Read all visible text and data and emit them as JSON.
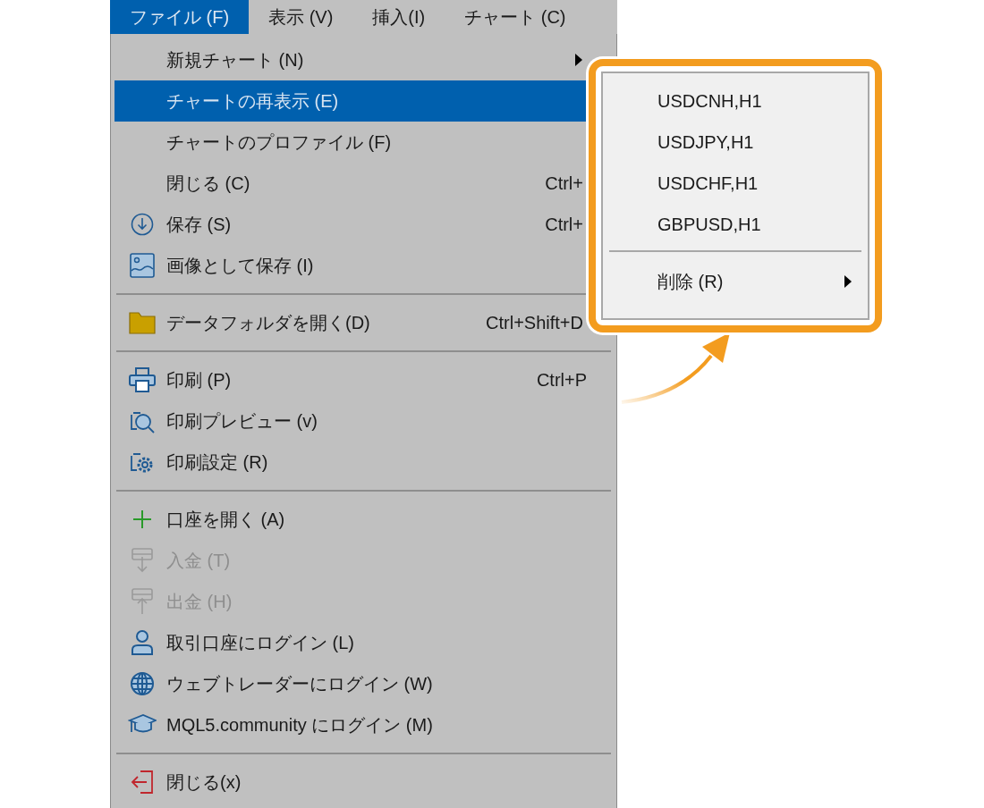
{
  "menubar": [
    {
      "label": "ファイル (F)",
      "selected": true
    },
    {
      "label": "表示 (V)",
      "selected": false
    },
    {
      "label": "挿入(I)",
      "selected": false
    },
    {
      "label": "チャート (C)",
      "selected": false
    }
  ],
  "menu": {
    "items": [
      {
        "kind": "item",
        "label": "新規チャート (N)",
        "submenu": true,
        "selected": false,
        "disabled": false
      },
      {
        "kind": "item",
        "label": "チャートの再表示 (E)",
        "selected": true,
        "disabled": false
      },
      {
        "kind": "item",
        "label": "チャートのプロファイル (F)",
        "selected": false,
        "disabled": false
      },
      {
        "kind": "item",
        "label": "閉じる (C)",
        "shortcut": "Ctrl+",
        "selected": false,
        "disabled": false
      },
      {
        "kind": "item",
        "label": "保存 (S)",
        "shortcut": "Ctrl+",
        "selected": false,
        "disabled": false
      },
      {
        "kind": "item",
        "label": "画像として保存 (I)",
        "selected": false,
        "disabled": false
      },
      {
        "kind": "separator"
      },
      {
        "kind": "item",
        "label": "データフォルダを開く(D)",
        "shortcut": "Ctrl+Shift+D",
        "selected": false,
        "disabled": false
      },
      {
        "kind": "separator"
      },
      {
        "kind": "item",
        "label": "印刷 (P)",
        "shortcut": "Ctrl+P",
        "selected": false,
        "disabled": false
      },
      {
        "kind": "item",
        "label": "印刷プレビュー (v)",
        "selected": false,
        "disabled": false
      },
      {
        "kind": "item",
        "label": "印刷設定 (R)",
        "selected": false,
        "disabled": false
      },
      {
        "kind": "separator"
      },
      {
        "kind": "item",
        "label": "口座を開く (A)",
        "selected": false,
        "disabled": false
      },
      {
        "kind": "item",
        "label": "入金 (T)",
        "selected": false,
        "disabled": true
      },
      {
        "kind": "item",
        "label": "出金 (H)",
        "selected": false,
        "disabled": true
      },
      {
        "kind": "item",
        "label": "取引口座にログイン (L)",
        "selected": false,
        "disabled": false
      },
      {
        "kind": "item",
        "label": "ウェブトレーダーにログイン (W)",
        "selected": false,
        "disabled": false
      },
      {
        "kind": "item",
        "label": "MQL5.community にログイン (M)",
        "selected": false,
        "disabled": false
      },
      {
        "kind": "separator"
      },
      {
        "kind": "item",
        "label": "閉じる(x)",
        "selected": false,
        "disabled": false
      }
    ]
  },
  "submenu": {
    "items": [
      {
        "kind": "item",
        "label": "USDCNH,H1"
      },
      {
        "kind": "item",
        "label": "USDJPY,H1"
      },
      {
        "kind": "item",
        "label": "USDCHF,H1"
      },
      {
        "kind": "item",
        "label": "GBPUSD,H1"
      },
      {
        "kind": "separator"
      },
      {
        "kind": "item",
        "label": "削除 (R)",
        "submenu": true
      }
    ]
  }
}
